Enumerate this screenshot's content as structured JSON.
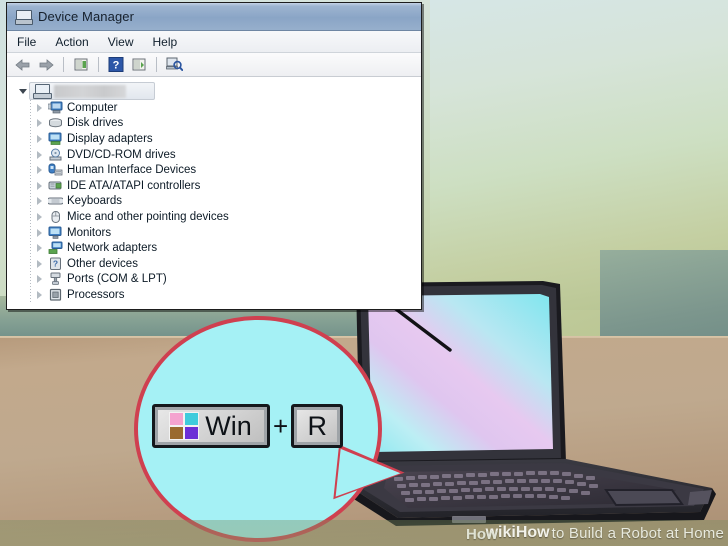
{
  "window": {
    "title": "Device Manager",
    "title_icon": "computer-icon",
    "menu": [
      {
        "label": "File"
      },
      {
        "label": "Action"
      },
      {
        "label": "View"
      },
      {
        "label": "Help"
      }
    ],
    "toolbar": [
      {
        "name": "back-arrow-icon",
        "label": "Back"
      },
      {
        "name": "forward-arrow-icon",
        "label": "Forward"
      },
      {
        "name": "properties-icon",
        "label": "Properties"
      },
      {
        "name": "help-icon",
        "label": "Help"
      },
      {
        "name": "update-driver-icon",
        "label": "Update Driver Software"
      },
      {
        "name": "scan-hardware-icon",
        "label": "Scan for hardware changes"
      }
    ],
    "tree": {
      "root": {
        "label": "",
        "redacted": true,
        "icon": "computer-icon",
        "expanded": true
      },
      "items": [
        {
          "label": "Computer",
          "icon": "computer-icon"
        },
        {
          "label": "Disk drives",
          "icon": "disk-drive-icon"
        },
        {
          "label": "Display adapters",
          "icon": "display-adapter-icon"
        },
        {
          "label": "DVD/CD-ROM drives",
          "icon": "dvd-drive-icon"
        },
        {
          "label": "Human Interface Devices",
          "icon": "hid-icon"
        },
        {
          "label": "IDE ATA/ATAPI controllers",
          "icon": "ide-controller-icon"
        },
        {
          "label": "Keyboards",
          "icon": "keyboard-icon"
        },
        {
          "label": "Mice and other pointing devices",
          "icon": "mouse-icon"
        },
        {
          "label": "Monitors",
          "icon": "monitor-icon"
        },
        {
          "label": "Network adapters",
          "icon": "network-adapter-icon"
        },
        {
          "label": "Other devices",
          "icon": "other-device-icon"
        },
        {
          "label": "Ports (COM & LPT)",
          "icon": "port-icon"
        },
        {
          "label": "Processors",
          "icon": "processor-icon"
        }
      ]
    }
  },
  "callout": {
    "shortcut": {
      "win_label": "Win",
      "plus": "+",
      "key_label": "R"
    },
    "logo_colors": {
      "top_left": "#f4a3cf",
      "top_right": "#3fcbdc",
      "bottom_left": "#9a6a2f",
      "bottom_right": "#6b2fd6"
    },
    "bubble_fill": "#a5f1f5",
    "bubble_border": "#cf4050"
  },
  "watermark": {
    "brand": "wikiHow",
    "text": "to Build a Robot at Home",
    "overlap": "How"
  },
  "scene": {
    "wall_color": "#c9d9c4",
    "desk_color": "#bda88c",
    "laptop_body_color": "#2b2b31",
    "screen_gradient": [
      "#bff4f7",
      "#e4c3ef",
      "#7fe9ef"
    ]
  }
}
